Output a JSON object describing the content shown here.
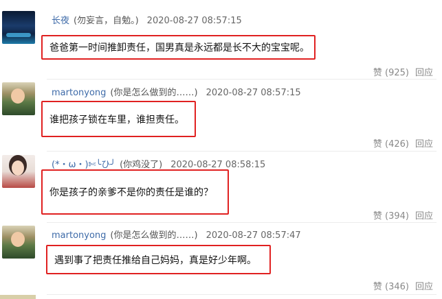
{
  "comments": [
    {
      "username": "长夜",
      "tagline": "(勿妄言，自勉。)",
      "time": "2020-08-27 08:57:15",
      "text": "爸爸第一时间推卸责任，国男真是永远都是长不大的宝宝呢。",
      "like_label": "赞",
      "like_count": "(925)",
      "reply_label": "回应"
    },
    {
      "username": "martonyong",
      "tagline": "(你是怎么做到的……)",
      "time": "2020-08-27 08:57:15",
      "text": "谁把孩子锁在车里，谁担责任。",
      "like_label": "赞",
      "like_count": "(426)",
      "reply_label": "回应"
    },
    {
      "username": "(*・ω・)✄╰ひ╯",
      "tagline": "(你鸡没了)",
      "time": "2020-08-27 08:58:15",
      "text": "你是孩子的亲爹不是你的责任是谁的？",
      "like_label": "赞",
      "like_count": "(394)",
      "reply_label": "回应"
    },
    {
      "username": "martonyong",
      "tagline": "(你是怎么做到的……)",
      "time": "2020-08-27 08:57:47",
      "text": "遇到事了把责任推给自己妈妈，真是好少年啊。",
      "like_label": "赞",
      "like_count": "(346)",
      "reply_label": "回应"
    }
  ]
}
